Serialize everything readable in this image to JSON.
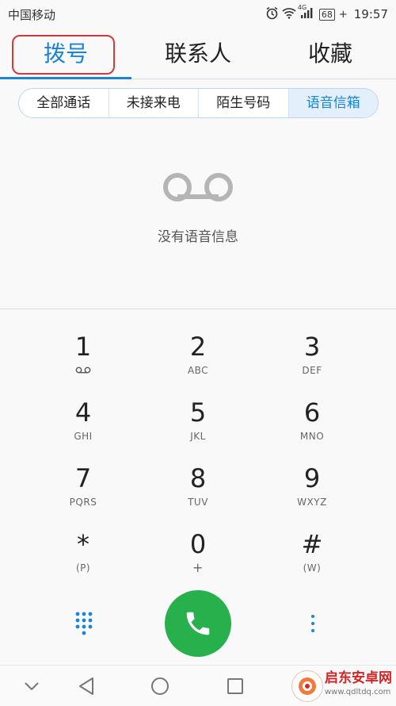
{
  "status_bar": {
    "carrier": "中国移动",
    "network_label": "4G",
    "battery": "68",
    "time": "19:57"
  },
  "tabs": [
    {
      "label": "拨号",
      "active": true
    },
    {
      "label": "联系人",
      "active": false
    },
    {
      "label": "收藏",
      "active": false
    }
  ],
  "filters": [
    {
      "label": "全部通话",
      "active": false
    },
    {
      "label": "未接来电",
      "active": false
    },
    {
      "label": "陌生号码",
      "active": false
    },
    {
      "label": "语音信箱",
      "active": true
    }
  ],
  "empty_state": {
    "icon": "voicemail-icon",
    "text": "没有语音信息"
  },
  "keypad": [
    {
      "digit": "1",
      "sub": ""
    },
    {
      "digit": "2",
      "sub": "ABC"
    },
    {
      "digit": "3",
      "sub": "DEF"
    },
    {
      "digit": "4",
      "sub": "GHI"
    },
    {
      "digit": "5",
      "sub": "JKL"
    },
    {
      "digit": "6",
      "sub": "MNO"
    },
    {
      "digit": "7",
      "sub": "PQRS"
    },
    {
      "digit": "8",
      "sub": "TUV"
    },
    {
      "digit": "9",
      "sub": "WXYZ"
    },
    {
      "digit": "*",
      "sub": "(P)"
    },
    {
      "digit": "0",
      "sub": "+"
    },
    {
      "digit": "#",
      "sub": "(W)"
    }
  ],
  "watermark": {
    "name": "启东安卓网",
    "url": "www.qdltdq.com"
  },
  "colors": {
    "accent": "#1a84d8",
    "call": "#27b04c",
    "highlight": "#d73838"
  }
}
